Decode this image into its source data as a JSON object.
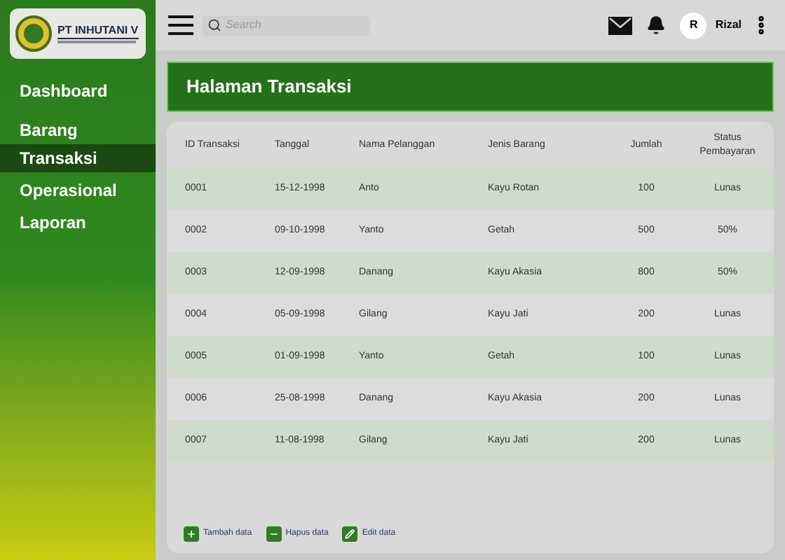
{
  "logo": {
    "title": "PT INHUTANI V"
  },
  "sidebar": {
    "items": [
      {
        "label": "Dashboard",
        "selected": false
      },
      {
        "label": "Barang",
        "selected": false
      },
      {
        "label": "Transaksi",
        "selected": true
      },
      {
        "label": "Operasional",
        "selected": false
      },
      {
        "label": "Laporan",
        "selected": false
      }
    ]
  },
  "topbar": {
    "search": {
      "placeholder": "Search"
    },
    "avatar": "R",
    "user": "Rizal"
  },
  "page_title": "Halaman Transaksi",
  "table": {
    "columns": [
      "ID Transaksi",
      "Tanggal",
      "Nama Pelanggan",
      "Jenis Barang",
      "Jumlah",
      "Status Pembayaran"
    ],
    "rows": [
      [
        "0001",
        "15-12-1998",
        "Anto",
        "Kayu Rotan",
        "100",
        "Lunas"
      ],
      [
        "0002",
        "09-10-1998",
        "Yanto",
        "Getah",
        "500",
        "50%"
      ],
      [
        "0003",
        "12-09-1998",
        "Danang",
        "Kayu Akasia",
        "800",
        "50%"
      ],
      [
        "0004",
        "05-09-1998",
        "Gilang",
        "Kayu Jati",
        "200",
        "Lunas"
      ],
      [
        "0005",
        "01-09-1998",
        "Yanto",
        "Getah",
        "100",
        "Lunas"
      ],
      [
        "0006",
        "25-08-1998",
        "Danang",
        "Kayu Akasia",
        "200",
        "Lunas"
      ],
      [
        "0007",
        "11-08-1998",
        "Gilang",
        "Kayu Jati",
        "200",
        "Lunas"
      ]
    ]
  },
  "actions": [
    {
      "kind": "add",
      "label": "Tambah data"
    },
    {
      "kind": "delete",
      "label": "Hapus data"
    },
    {
      "kind": "edit",
      "label": "Edit data"
    }
  ]
}
